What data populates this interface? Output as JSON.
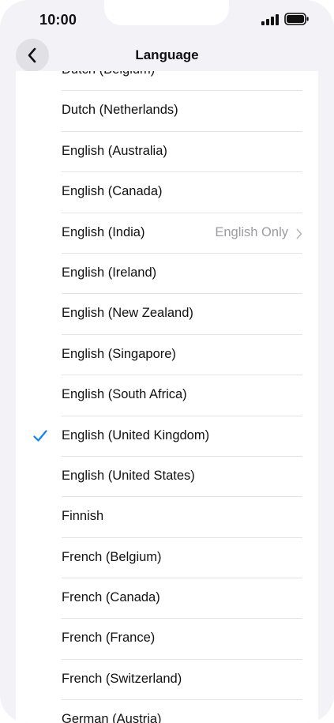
{
  "status": {
    "time": "10:00"
  },
  "nav": {
    "title": "Language"
  },
  "languages": [
    {
      "label": "Dutch (Belgium)"
    },
    {
      "label": "Dutch (Netherlands)"
    },
    {
      "label": "English (Australia)"
    },
    {
      "label": "English (Canada)"
    },
    {
      "label": "English (India)",
      "detail": "English Only"
    },
    {
      "label": "English (Ireland)"
    },
    {
      "label": "English (New Zealand)"
    },
    {
      "label": "English (Singapore)"
    },
    {
      "label": "English (South Africa)"
    },
    {
      "label": "English (United Kingdom)",
      "selected": true
    },
    {
      "label": "English (United States)"
    },
    {
      "label": "Finnish"
    },
    {
      "label": "French (Belgium)"
    },
    {
      "label": "French (Canada)"
    },
    {
      "label": "French (France)"
    },
    {
      "label": "French (Switzerland)"
    },
    {
      "label": "German (Austria)"
    }
  ],
  "colors": {
    "accent": "#0a84ff",
    "secondary_text": "#9b9ba1",
    "background": "#f2f2f7"
  }
}
